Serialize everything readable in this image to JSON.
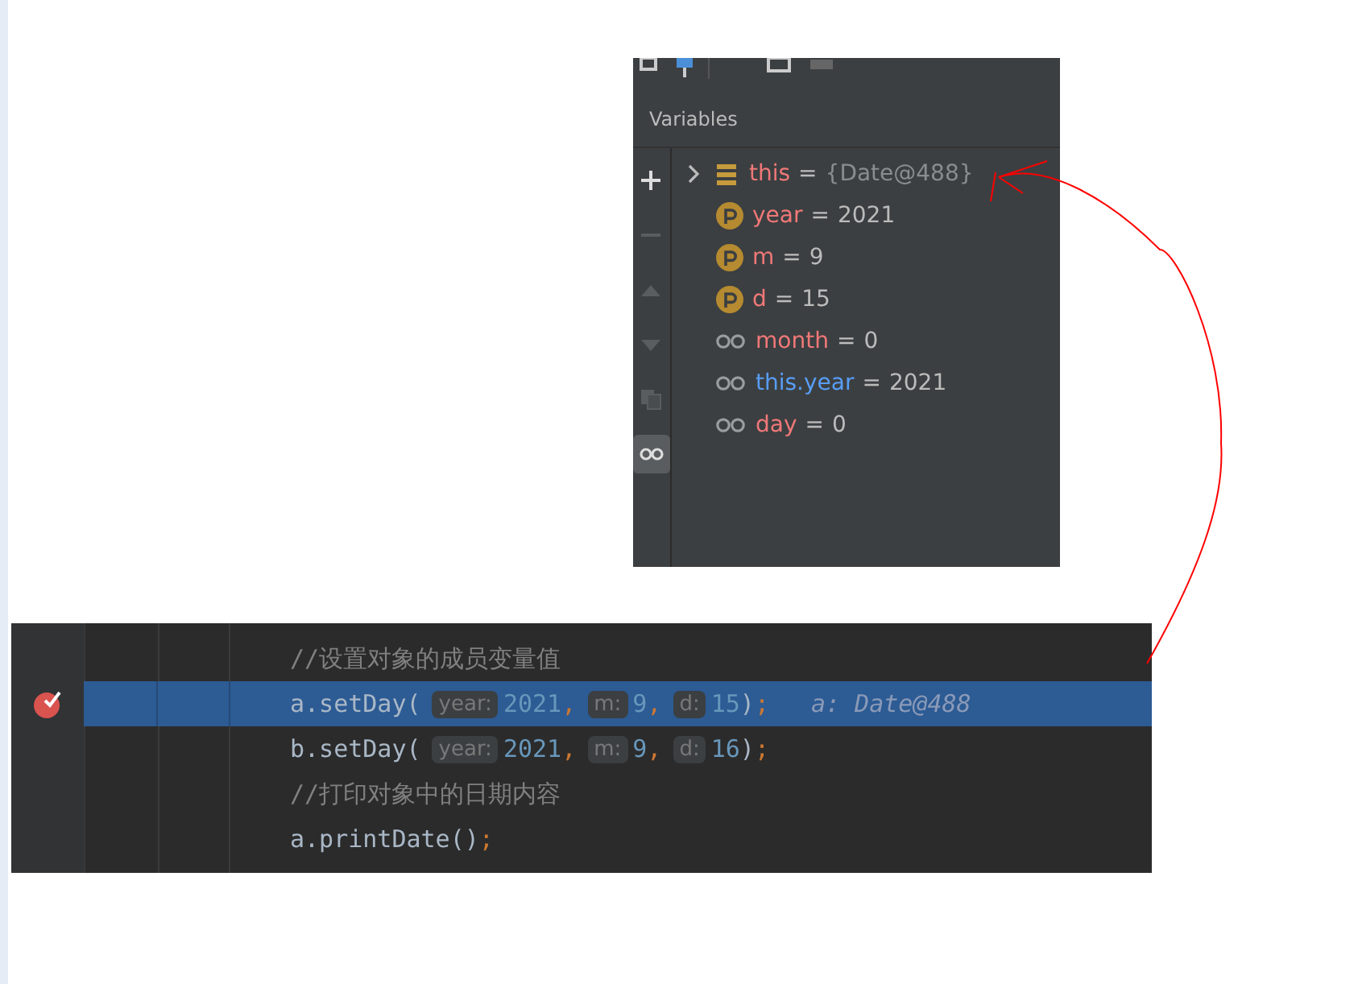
{
  "variables_panel": {
    "title": "Variables",
    "toolbar": [
      {
        "kind": "add",
        "selected": false
      },
      {
        "kind": "remove",
        "selected": false
      },
      {
        "kind": "up",
        "selected": false
      },
      {
        "kind": "down",
        "selected": false
      },
      {
        "kind": "copy",
        "selected": false
      },
      {
        "kind": "watches",
        "selected": true
      }
    ],
    "rows": [
      {
        "kind": "object",
        "expanded": false,
        "name": "this",
        "color": "#f07878",
        "operator": "=",
        "value": "{Date@488}"
      },
      {
        "kind": "param",
        "name": "year",
        "color": "#f07878",
        "operator": "=",
        "value": "2021"
      },
      {
        "kind": "param",
        "name": "m",
        "color": "#f07878",
        "operator": "=",
        "value": "9"
      },
      {
        "kind": "param",
        "name": "d",
        "color": "#f07878",
        "operator": "=",
        "value": "15"
      },
      {
        "kind": "watch",
        "name": "month",
        "color": "#f07878",
        "operator": "=",
        "value": "0"
      },
      {
        "kind": "watch",
        "name": "this.year",
        "color": "#589df6",
        "operator": "=",
        "value": "2021"
      },
      {
        "kind": "watch",
        "name": "day",
        "color": "#f07878",
        "operator": "=",
        "value": "0"
      }
    ]
  },
  "editor": {
    "lines": [
      {
        "selected": false,
        "breakpoint": false,
        "tokens": [
          {
            "kind": "comment",
            "text": "//设置对象的成员变量值"
          }
        ]
      },
      {
        "selected": true,
        "breakpoint": true,
        "tokens": [
          {
            "kind": "plain",
            "text": "a.setDay("
          },
          {
            "kind": "hint",
            "text": "year:"
          },
          {
            "kind": "number",
            "text": "2021"
          },
          {
            "kind": "punct",
            "text": ","
          },
          {
            "kind": "hint",
            "text": "m:"
          },
          {
            "kind": "number",
            "text": "9"
          },
          {
            "kind": "punct",
            "text": ","
          },
          {
            "kind": "hint",
            "text": "d:"
          },
          {
            "kind": "number",
            "text": "15"
          },
          {
            "kind": "plain",
            "text": ")"
          },
          {
            "kind": "punct",
            "text": ";"
          },
          {
            "kind": "inline",
            "text": "a: Date@488"
          }
        ]
      },
      {
        "selected": false,
        "breakpoint": false,
        "tokens": [
          {
            "kind": "plain",
            "text": "b.setDay("
          },
          {
            "kind": "hint",
            "text": "year:"
          },
          {
            "kind": "number",
            "text": "2021"
          },
          {
            "kind": "punct",
            "text": ","
          },
          {
            "kind": "hint",
            "text": "m:"
          },
          {
            "kind": "number",
            "text": "9"
          },
          {
            "kind": "punct",
            "text": ","
          },
          {
            "kind": "hint",
            "text": "d:"
          },
          {
            "kind": "number",
            "text": "16"
          },
          {
            "kind": "plain",
            "text": ")"
          },
          {
            "kind": "punct",
            "text": ";"
          }
        ]
      },
      {
        "selected": false,
        "breakpoint": false,
        "tokens": [
          {
            "kind": "comment",
            "text": "//打印对象中的日期内容"
          }
        ]
      },
      {
        "selected": false,
        "breakpoint": false,
        "tokens": [
          {
            "kind": "plain",
            "text": "a.printDate()"
          },
          {
            "kind": "punct",
            "text": ";"
          }
        ]
      }
    ]
  }
}
